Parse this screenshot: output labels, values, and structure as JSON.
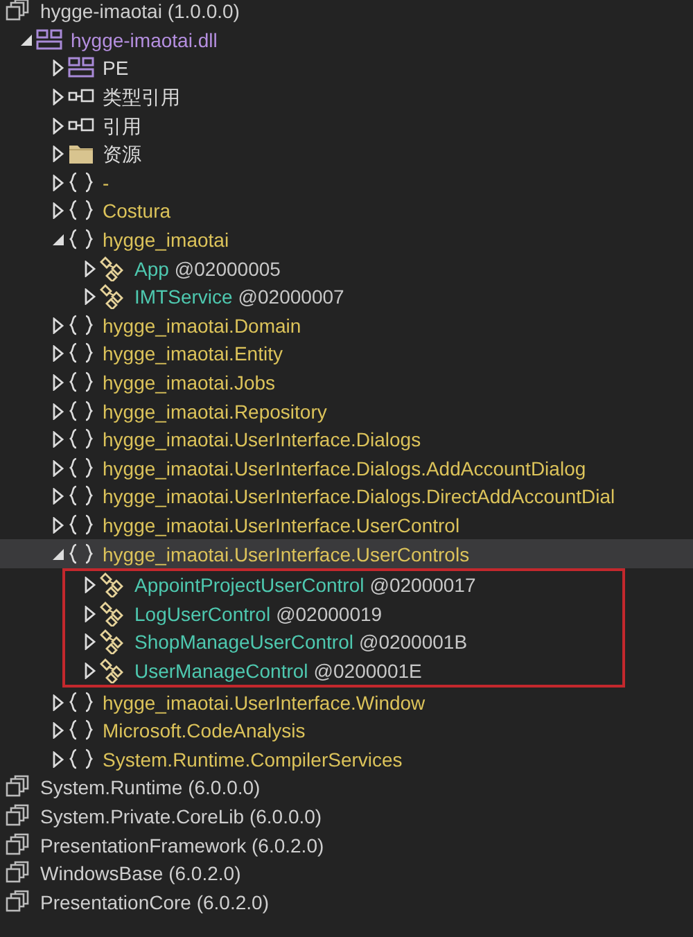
{
  "tree": [
    {
      "kind": "assembly",
      "label": "hygge-imaotai (1.0.0.0)",
      "children": [
        {
          "kind": "module",
          "label": "hygge-imaotai.dll",
          "expanded": true,
          "children": [
            {
              "kind": "pe",
              "label": "PE",
              "expanded": false
            },
            {
              "kind": "reference",
              "label": "类型引用",
              "expanded": false
            },
            {
              "kind": "reference",
              "label": "引用",
              "expanded": false
            },
            {
              "kind": "folder",
              "label": "资源",
              "expanded": false
            },
            {
              "kind": "namespace",
              "label": "-",
              "expanded": false
            },
            {
              "kind": "namespace",
              "label": "Costura",
              "expanded": false
            },
            {
              "kind": "namespace",
              "label": "hygge_imaotai",
              "expanded": true,
              "children": [
                {
                  "kind": "class",
                  "label": "App",
                  "token": "@02000005",
                  "expanded": false
                },
                {
                  "kind": "class",
                  "label": "IMTService",
                  "token": "@02000007",
                  "expanded": false
                }
              ]
            },
            {
              "kind": "namespace",
              "label": "hygge_imaotai.Domain",
              "expanded": false
            },
            {
              "kind": "namespace",
              "label": "hygge_imaotai.Entity",
              "expanded": false
            },
            {
              "kind": "namespace",
              "label": "hygge_imaotai.Jobs",
              "expanded": false
            },
            {
              "kind": "namespace",
              "label": "hygge_imaotai.Repository",
              "expanded": false
            },
            {
              "kind": "namespace",
              "label": "hygge_imaotai.UserInterface.Dialogs",
              "expanded": false
            },
            {
              "kind": "namespace",
              "label": "hygge_imaotai.UserInterface.Dialogs.AddAccountDialog",
              "expanded": false
            },
            {
              "kind": "namespace",
              "label": "hygge_imaotai.UserInterface.Dialogs.DirectAddAccountDial",
              "expanded": false
            },
            {
              "kind": "namespace",
              "label": "hygge_imaotai.UserInterface.UserControl",
              "expanded": false
            },
            {
              "kind": "namespace",
              "label": "hygge_imaotai.UserInterface.UserControls",
              "expanded": true,
              "selected": true,
              "boxed": true,
              "children": [
                {
                  "kind": "class",
                  "label": "AppointProjectUserControl",
                  "token": "@02000017",
                  "expanded": false
                },
                {
                  "kind": "class",
                  "label": "LogUserControl",
                  "token": "@02000019",
                  "expanded": false
                },
                {
                  "kind": "class",
                  "label": "ShopManageUserControl",
                  "token": "@0200001B",
                  "expanded": false
                },
                {
                  "kind": "class",
                  "label": "UserManageControl",
                  "token": "@0200001E",
                  "expanded": false
                }
              ]
            },
            {
              "kind": "namespace",
              "label": "hygge_imaotai.UserInterface.Window",
              "expanded": false
            },
            {
              "kind": "namespace",
              "label": "Microsoft.CodeAnalysis",
              "expanded": false
            },
            {
              "kind": "namespace",
              "label": "System.Runtime.CompilerServices",
              "expanded": false
            }
          ]
        }
      ]
    },
    {
      "kind": "assembly",
      "label": "System.Runtime (6.0.0.0)"
    },
    {
      "kind": "assembly",
      "label": "System.Private.CoreLib (6.0.0.0)"
    },
    {
      "kind": "assembly",
      "label": "PresentationFramework (6.0.2.0)"
    },
    {
      "kind": "assembly",
      "label": "WindowsBase (6.0.2.0)"
    },
    {
      "kind": "assembly",
      "label": "PresentationCore (6.0.2.0)"
    }
  ]
}
